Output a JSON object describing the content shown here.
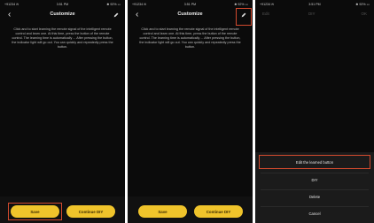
{
  "screens": [
    {
      "status": {
        "left": "+91234 ✉",
        "time": "3:51 PM",
        "right": "✱ 92% ▭"
      },
      "title": "Customize",
      "description": "Click and to start learning the remote signal of the intelligent remote control and learn one. At this time, press the button of the remote control. The learning time is automatically ... After pressing the button, the indicator light will go out. You can quickly and repeatedly press the button.",
      "buttons": {
        "save": "Save",
        "continue": "Continue DIY"
      }
    },
    {
      "status": {
        "left": "+91234 ✉",
        "time": "3:51 PM",
        "right": "✱ 92% ▭"
      },
      "title": "Customize",
      "description": "Click and to start learning the remote signal of the intelligent remote control and learn one. At this time, press the button of the remote control. The learning time is automatically ... After pressing the button, the indicator light will go out. You can quickly and repeatedly press the button.",
      "buttons": {
        "save": "Save",
        "continue": "Continue DIY"
      }
    },
    {
      "status": {
        "left": "+91234 ✉",
        "time": "3:51 PM",
        "right": "✱ 92% ▭"
      },
      "ghost_header": {
        "left": "Edit",
        "center": "DIY",
        "right": "OK"
      },
      "menu": [
        "Edit the learned button",
        "DIY",
        "Delete",
        "Cancel"
      ]
    }
  ],
  "colors": {
    "accent": "#f0c42b",
    "highlight": "#d24a2e",
    "background": "#0b0b0b"
  },
  "icons": {
    "back": "chevron-left-icon",
    "edit": "pencil-icon"
  }
}
